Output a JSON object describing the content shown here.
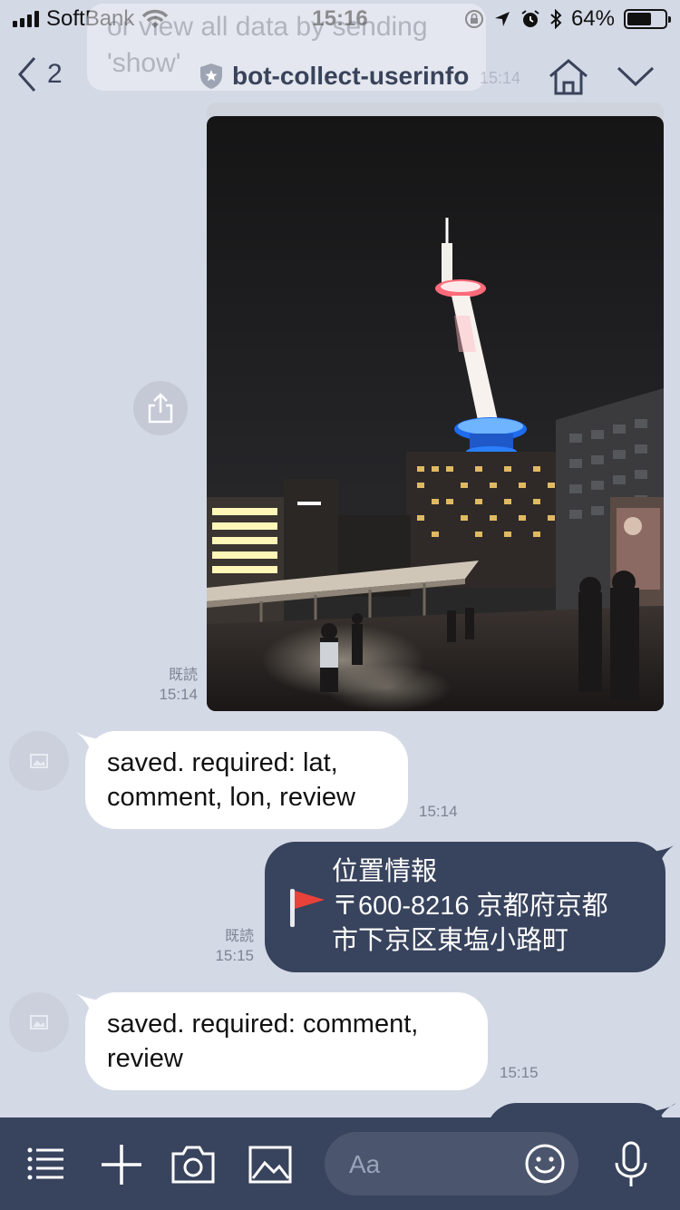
{
  "status_bar": {
    "carrier": "SoftBank",
    "time": "15:16",
    "battery_percent": "64%",
    "battery_level": 0.64
  },
  "ghost_notification": {
    "text_line1": "or view all data by sending",
    "text_line2": "'show'",
    "time": "15:14"
  },
  "nav": {
    "back_count": "2",
    "title": "bot-collect-userinfo",
    "back_icon": "chevron-left-icon",
    "shield_icon": "shield-star-icon",
    "home_icon": "home-icon",
    "menu_icon": "chevron-down-icon"
  },
  "messages": [
    {
      "type": "image",
      "direction": "out",
      "read_label": "既読",
      "time": "15:14"
    },
    {
      "type": "text",
      "direction": "in",
      "text_line1": "saved. required: lat,",
      "text_line2": "comment, lon, review",
      "time": "15:14"
    },
    {
      "type": "location",
      "direction": "out",
      "text_line1": "位置情報",
      "text_line2": "〒600-8216 京都府京都",
      "text_line3": "市下京区東塩小路町",
      "read_label": "既読",
      "time": "15:15"
    },
    {
      "type": "text",
      "direction": "in",
      "text_line1": "saved. required: comment,",
      "text_line2": "review",
      "time": "15:15"
    }
  ],
  "toolbar": {
    "input_placeholder": "Aa",
    "icons": [
      "menu-icon",
      "plus-icon",
      "camera-icon",
      "image-icon",
      "emoji-icon",
      "microphone-icon"
    ]
  },
  "colors": {
    "background": "#d4d9e6",
    "outgoing_bubble": "#38435d",
    "incoming_bubble": "#ffffff",
    "toolbar": "#38435d",
    "flag": "#e8423b"
  }
}
